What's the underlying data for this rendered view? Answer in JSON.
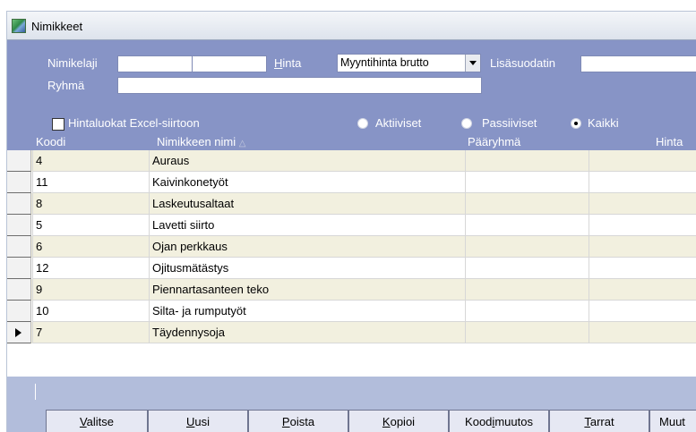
{
  "window": {
    "title": "Nimikkeet"
  },
  "filters": {
    "nimikelaji_label": "Nimikelaji",
    "ryhma_label": "Ryhmä",
    "hinta_label": "Hinta",
    "hinta_selected": "Myyntihinta brutto",
    "lisasuodatin_label": "Lisäsuodatin",
    "hintaluokat_label": "Hintaluokat Excel-siirtoon",
    "hintaluokat_checked": false,
    "status": {
      "aktiiviset": "Aktiiviset",
      "passiiviset": "Passiiviset",
      "kaikki": "Kaikki",
      "selected": "kaikki"
    }
  },
  "grid": {
    "columns": [
      "Koodi",
      "Nimikkeen nimi",
      "Pääryhmä",
      "Hinta"
    ],
    "sort_indicator": "△",
    "rows": [
      {
        "koodi": "4",
        "nimi": "Auraus"
      },
      {
        "koodi": "11",
        "nimi": "Kaivinkonetyöt"
      },
      {
        "koodi": "8",
        "nimi": "Laskeutusaltaat"
      },
      {
        "koodi": "5",
        "nimi": "Lavetti siirto"
      },
      {
        "koodi": "6",
        "nimi": "Ojan perkkaus"
      },
      {
        "koodi": "12",
        "nimi": "Ojitusmätästys"
      },
      {
        "koodi": "9",
        "nimi": "Piennartasanteen teko"
      },
      {
        "koodi": "10",
        "nimi": "Silta- ja rumputyöt"
      },
      {
        "koodi": "7",
        "nimi": "Täydennysoja"
      }
    ],
    "current_row": 9
  },
  "buttons": [
    {
      "pre": "",
      "key": "V",
      "post": "alitse"
    },
    {
      "pre": "",
      "key": "U",
      "post": "usi"
    },
    {
      "pre": "",
      "key": "P",
      "post": "oista"
    },
    {
      "pre": "",
      "key": "K",
      "post": "opioi"
    },
    {
      "pre": "Kood",
      "key": "i",
      "post": "muutos"
    },
    {
      "pre": "",
      "key": "T",
      "post": "arrat"
    },
    {
      "pre": "",
      "key": "M",
      "post": "uut"
    }
  ],
  "colors": {
    "panel": "#8794c6",
    "row_alt": "#f2f0df",
    "bottom_panel": "#b2bddb",
    "button_face": "#e6e8f3"
  }
}
